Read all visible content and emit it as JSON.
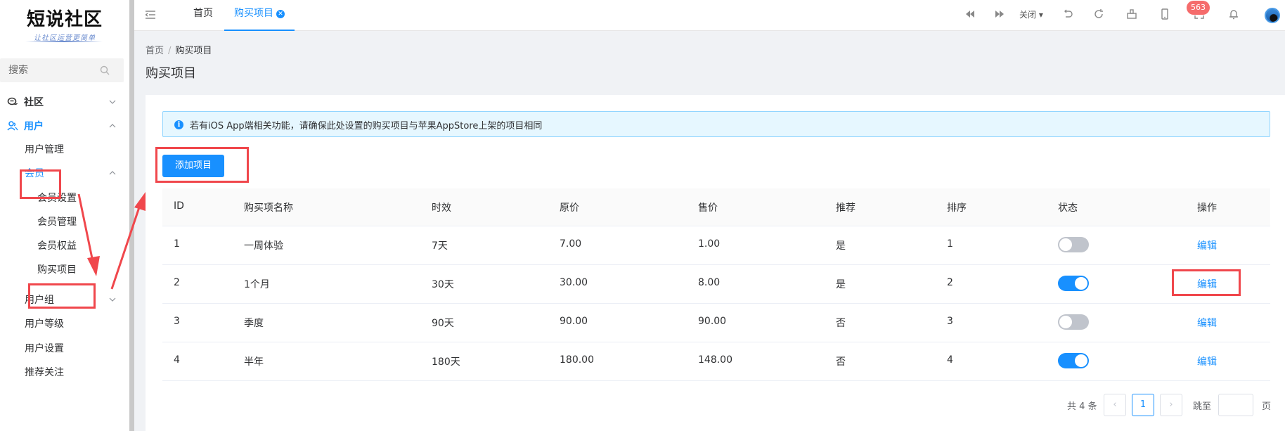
{
  "sidebar": {
    "logo_title": "短说社区",
    "logo_subtitle": "让社区运营更简单",
    "search_placeholder": "搜索",
    "items": [
      {
        "label": "社区"
      },
      {
        "label": "用户"
      },
      {
        "label": "用户管理"
      },
      {
        "label": "会员"
      },
      {
        "label": "会员设置"
      },
      {
        "label": "会员管理"
      },
      {
        "label": "会员权益"
      },
      {
        "label": "购买项目"
      },
      {
        "label": "用户组"
      },
      {
        "label": "用户等级"
      },
      {
        "label": "用户设置"
      },
      {
        "label": "推荐关注"
      }
    ]
  },
  "topbar": {
    "tabs": [
      {
        "label": "首页"
      },
      {
        "label": "购买项目"
      }
    ],
    "close_label": "关闭",
    "notification_count": "563"
  },
  "breadcrumb": {
    "home": "首页",
    "separator": "/",
    "current": "购买项目"
  },
  "page": {
    "title": "购买项目",
    "alert_text": "若有iOS App端相关功能，请确保此处设置的购买项目与苹果AppStore上架的项目相同",
    "add_button": "添加项目"
  },
  "table": {
    "columns": [
      "ID",
      "购买项名称",
      "时效",
      "原价",
      "售价",
      "推荐",
      "排序",
      "状态",
      "操作"
    ],
    "rows": [
      {
        "id": "1",
        "name": "一周体验",
        "duration": "7天",
        "original_price": "7.00",
        "price": "1.00",
        "recommended": "是",
        "sort": "1",
        "enabled": false,
        "action": "编辑"
      },
      {
        "id": "2",
        "name": "1个月",
        "duration": "30天",
        "original_price": "30.00",
        "price": "8.00",
        "recommended": "是",
        "sort": "2",
        "enabled": true,
        "action": "编辑"
      },
      {
        "id": "3",
        "name": "季度",
        "duration": "90天",
        "original_price": "90.00",
        "price": "90.00",
        "recommended": "否",
        "sort": "3",
        "enabled": false,
        "action": "编辑"
      },
      {
        "id": "4",
        "name": "半年",
        "duration": "180天",
        "original_price": "180.00",
        "price": "148.00",
        "recommended": "否",
        "sort": "4",
        "enabled": true,
        "action": "编辑"
      }
    ]
  },
  "pagination": {
    "total_text": "共 4 条",
    "current_page": "1",
    "jump_label": "跳至",
    "jump_suffix": "页"
  },
  "colors": {
    "accent": "#1890ff",
    "annotation": "#f0474c",
    "badge": "#f56c6c"
  }
}
